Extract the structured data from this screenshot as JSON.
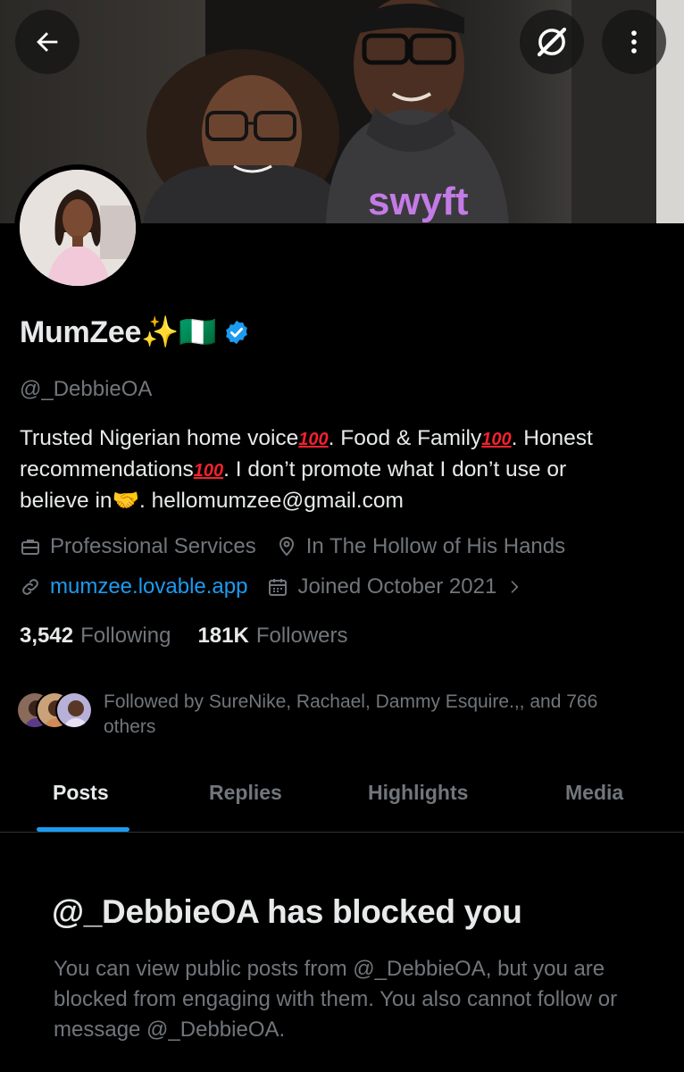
{
  "header": {
    "back_icon": "arrow-left-icon",
    "grok_icon": "grok-slash-circle-icon",
    "more_icon": "more-vertical-icon",
    "banner_text": "swyft"
  },
  "profile": {
    "display_name": "MumZee✨🇳🇬",
    "verified": true,
    "handle": "@_DebbieOA",
    "bio_lines": [
      {
        "a": "Trusted Nigerian home voice",
        "e1": "100",
        "b": ".  Food & Family",
        "e2": "100",
        "c": ".  Honest"
      },
      {
        "a": "recommendations",
        "e1": "100",
        "b": ".  I don’t promote what I don’t use or"
      },
      {
        "a": "believe in",
        "emoji": "🤝",
        "b": ".  hellomumzee@gmail.com"
      }
    ],
    "category": "Professional Services",
    "location": "In The Hollow of His Hands",
    "website": "mumzee.lovable.app",
    "joined": "Joined October 2021",
    "following_count": "3,542",
    "following_label": "Following",
    "followers_count": "181K",
    "followers_label": "Followers",
    "followed_by": "Followed by SureNike, Rachael, Dammy Esquire.,, and 766 others"
  },
  "tabs": [
    {
      "label": "Posts",
      "active": true
    },
    {
      "label": "Replies",
      "active": false
    },
    {
      "label": "Highlights",
      "active": false
    },
    {
      "label": "Media",
      "active": false
    }
  ],
  "blocked": {
    "title": "@_DebbieOA has blocked you",
    "body": "You can view public posts from @_DebbieOA, but you are blocked from engaging with them. You also cannot follow or message @_DebbieOA."
  },
  "colors": {
    "background": "#000000",
    "text": "#e7e9ea",
    "muted": "#71767b",
    "accent": "#1d9bf0",
    "divider": "#2f3336"
  }
}
